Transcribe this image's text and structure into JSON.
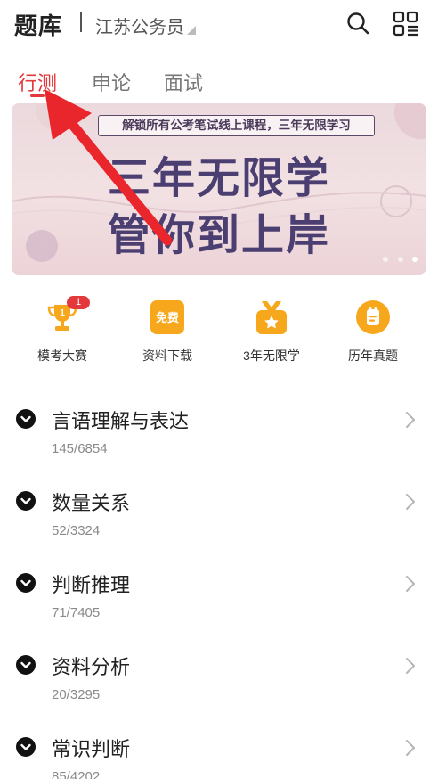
{
  "header": {
    "title": "题库",
    "region": "江苏公务员"
  },
  "tabs": [
    {
      "label": "行测",
      "active": true
    },
    {
      "label": "申论",
      "active": false
    },
    {
      "label": "面试",
      "active": false
    }
  ],
  "banner": {
    "subtitle": "解锁所有公考笔试线上课程，三年无限学习",
    "line1": "三年无限学",
    "line2": "管你到上岸",
    "slide_count": 3,
    "active_slide": 3
  },
  "quick_entries": [
    {
      "label": "模考大赛",
      "icon": "trophy-icon",
      "badge": "1"
    },
    {
      "label": "资料下载",
      "icon": "free-download-icon",
      "icon_text": "免费"
    },
    {
      "label": "3年无限学",
      "icon": "medal-star-icon"
    },
    {
      "label": "历年真题",
      "icon": "exam-paper-icon"
    }
  ],
  "categories": [
    {
      "title": "言语理解与表达",
      "progress": "145/6854"
    },
    {
      "title": "数量关系",
      "progress": "52/3324"
    },
    {
      "title": "判断推理",
      "progress": "71/7405"
    },
    {
      "title": "资料分析",
      "progress": "20/3295"
    },
    {
      "title": "常识判断",
      "progress": "85/4202"
    }
  ],
  "colors": {
    "accent": "#e4393c",
    "icon_orange": "#f7a71b",
    "banner_text": "#4b3f72",
    "annotation_arrow": "#e8262b"
  }
}
